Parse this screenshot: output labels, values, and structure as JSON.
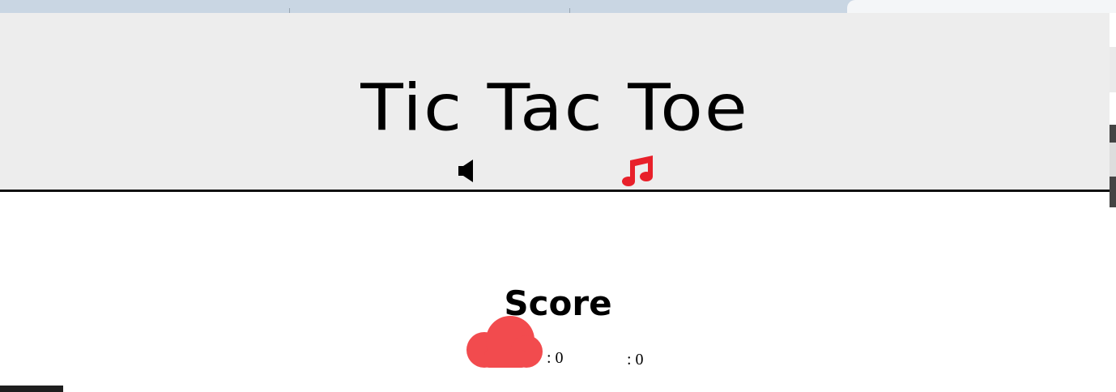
{
  "game": {
    "title": "Tic Tac Toe"
  },
  "controls": {
    "sound_icon": "speaker-icon",
    "music_icon": "music-note-icon",
    "music_color": "#e8202a"
  },
  "score": {
    "heading": "Score",
    "player_one": {
      "icon": "cloud-icon",
      "color": "#f24b4e",
      "label": ": 0"
    },
    "player_two": {
      "label": ": 0"
    }
  },
  "colors": {
    "header_bg": "#ededed",
    "page_bg": "#ffffff",
    "text": "#000000"
  }
}
